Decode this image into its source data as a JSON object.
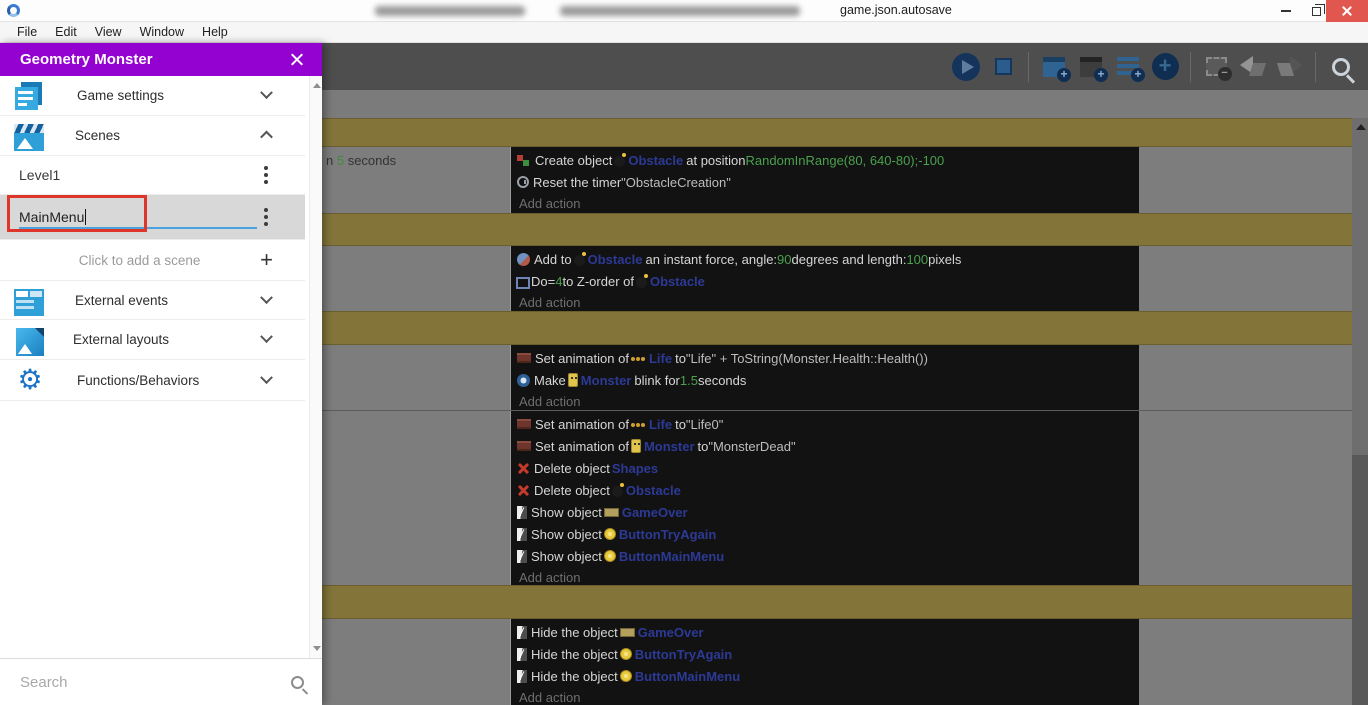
{
  "window": {
    "title": "game.json.autosave"
  },
  "menu_bar": {
    "items": [
      "File",
      "Edit",
      "View",
      "Window",
      "Help"
    ]
  },
  "project_manager": {
    "title": "Geometry Monster",
    "sections": [
      {
        "label": "Game settings",
        "icon": "game-settings-icon",
        "chevron": "down"
      },
      {
        "label": "Scenes",
        "icon": "scenes-icon",
        "chevron": "up"
      }
    ],
    "scenes": [
      {
        "name": "Level1"
      },
      {
        "name": "MainMenu",
        "editing": true
      }
    ],
    "add_scene_label": "Click to add a scene",
    "sections2": [
      {
        "label": "External events",
        "icon": "external-events-icon",
        "chevron": "down"
      },
      {
        "label": "External layouts",
        "icon": "external-layouts-icon",
        "chevron": "down"
      },
      {
        "label": "Functions/Behaviors",
        "icon": "functions-behaviors-icon",
        "chevron": "down"
      }
    ],
    "search_placeholder": "Search"
  },
  "toolbar": {
    "buttons": [
      {
        "name": "preview",
        "enabled": true
      },
      {
        "name": "debug",
        "enabled": true
      },
      {
        "sep": true
      },
      {
        "name": "add-event",
        "enabled": true
      },
      {
        "name": "add-subevent",
        "enabled": true
      },
      {
        "name": "add-comment",
        "enabled": true
      },
      {
        "name": "add-something",
        "enabled": true
      },
      {
        "sep": true
      },
      {
        "name": "delete-selection",
        "enabled": false
      },
      {
        "name": "undo",
        "enabled": false
      },
      {
        "name": "redo",
        "enabled": false
      },
      {
        "sep": true
      },
      {
        "name": "search",
        "enabled": true
      }
    ]
  },
  "events_sheet": {
    "add_action_label": "Add action",
    "colors": {
      "comment_bar": "#83753a",
      "accent_purple": "#9402d2",
      "value_green": "#4aa14e",
      "object_navy": "#2c3a96"
    },
    "rows": [
      {
        "type": "comment"
      },
      {
        "type": "event",
        "condition": [
          [
            "t",
            "n "
          ],
          [
            "g",
            "5"
          ],
          [
            "t",
            " seconds"
          ]
        ],
        "actions": [
          {
            "icon": "create",
            "segs": [
              [
                "t",
                "Create object "
              ],
              [
                "obj",
                "bomb",
                "Obstacle"
              ],
              [
                "t",
                " at position "
              ],
              [
                "g",
                "RandomInRange(80, 640-80);-100"
              ]
            ]
          },
          {
            "icon": "timer",
            "segs": [
              [
                "t",
                "Reset the timer "
              ],
              [
                "q",
                "\"ObstacleCreation\""
              ]
            ]
          }
        ]
      },
      {
        "type": "comment"
      },
      {
        "type": "event",
        "actions": [
          {
            "icon": "force",
            "segs": [
              [
                "t",
                "Add to "
              ],
              [
                "obj",
                "bomb",
                "Obstacle"
              ],
              [
                "t",
                " an instant force, angle: "
              ],
              [
                "g",
                "90"
              ],
              [
                "t",
                " degrees and length: "
              ],
              [
                "g",
                "100"
              ],
              [
                "t",
                " pixels"
              ]
            ]
          },
          {
            "icon": "zorder",
            "segs": [
              [
                "t",
                "Do "
              ],
              [
                "t",
                "= "
              ],
              [
                "g",
                "4"
              ],
              [
                "t",
                " to Z-order of "
              ],
              [
                "obj",
                "bomb",
                "Obstacle"
              ]
            ]
          }
        ]
      },
      {
        "type": "comment"
      },
      {
        "type": "event",
        "actions": [
          {
            "icon": "anim",
            "segs": [
              [
                "t",
                "Set animation of "
              ],
              [
                "obj",
                "life",
                "Life"
              ],
              [
                "t",
                " to "
              ],
              [
                "q",
                "\"Life\" + ToString(Monster.Health::Health())"
              ]
            ]
          },
          {
            "icon": "blink",
            "segs": [
              [
                "t",
                "Make "
              ],
              [
                "obj",
                "monster",
                "Monster"
              ],
              [
                "t",
                " blink for "
              ],
              [
                "g",
                "1.5"
              ],
              [
                "t",
                " seconds"
              ]
            ]
          }
        ]
      },
      {
        "type": "event",
        "actions": [
          {
            "icon": "anim",
            "segs": [
              [
                "t",
                "Set animation of "
              ],
              [
                "obj",
                "life",
                "Life"
              ],
              [
                "t",
                " to "
              ],
              [
                "q",
                "\"Life0\""
              ]
            ]
          },
          {
            "icon": "anim",
            "segs": [
              [
                "t",
                "Set animation of "
              ],
              [
                "obj",
                "monster",
                "Monster"
              ],
              [
                "t",
                " to "
              ],
              [
                "q",
                "\"MonsterDead\""
              ]
            ]
          },
          {
            "icon": "delete",
            "segs": [
              [
                "t",
                "Delete object "
              ],
              [
                "obj",
                "none",
                "Shapes"
              ]
            ]
          },
          {
            "icon": "delete",
            "segs": [
              [
                "t",
                "Delete object "
              ],
              [
                "obj",
                "bomb",
                "Obstacle"
              ]
            ]
          },
          {
            "icon": "vis",
            "segs": [
              [
                "t",
                "Show object "
              ],
              [
                "obj",
                "banner",
                "GameOver"
              ]
            ]
          },
          {
            "icon": "vis",
            "segs": [
              [
                "t",
                "Show object "
              ],
              [
                "obj",
                "button",
                "ButtonTryAgain"
              ]
            ]
          },
          {
            "icon": "vis",
            "segs": [
              [
                "t",
                "Show object "
              ],
              [
                "obj",
                "button",
                "ButtonMainMenu"
              ]
            ]
          }
        ]
      },
      {
        "type": "comment"
      },
      {
        "type": "event",
        "actions": [
          {
            "icon": "vis",
            "segs": [
              [
                "t",
                "Hide the object "
              ],
              [
                "obj",
                "banner",
                "GameOver"
              ]
            ]
          },
          {
            "icon": "vis",
            "segs": [
              [
                "t",
                "Hide the object "
              ],
              [
                "obj",
                "button",
                "ButtonTryAgain"
              ]
            ]
          },
          {
            "icon": "vis",
            "segs": [
              [
                "t",
                "Hide the object "
              ],
              [
                "obj",
                "button",
                "ButtonMainMenu"
              ]
            ]
          }
        ]
      }
    ]
  }
}
